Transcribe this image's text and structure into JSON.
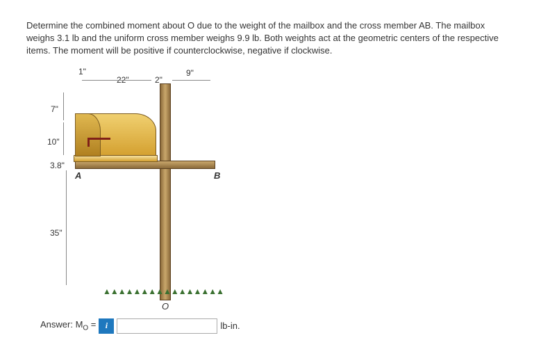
{
  "problem": {
    "text": "Determine the combined moment about O due to the weight of the mailbox and the cross member AB. The mailbox weighs 3.1 lb and the uniform cross member weighs 9.9 lb. Both weights act at the geometric centers of the respective items. The moment will be positive if counterclockwise, negative if clockwise."
  },
  "diagram": {
    "dimensions": {
      "top_offset": "1\"",
      "horizontal_span": "22\"",
      "post_half": "2\"",
      "right_arm": "9\"",
      "upper_height": "7\"",
      "mailbox_height": "10\"",
      "cross_thickness": "3.8\"",
      "ground_clear": "35\""
    },
    "labels": {
      "left_end": "A",
      "right_end": "B",
      "origin": "O"
    }
  },
  "answer": {
    "label_prefix": "Answer: M",
    "label_sub": "O",
    "label_suffix": " = ",
    "info_glyph": "i",
    "value": "",
    "unit": "lb-in."
  }
}
